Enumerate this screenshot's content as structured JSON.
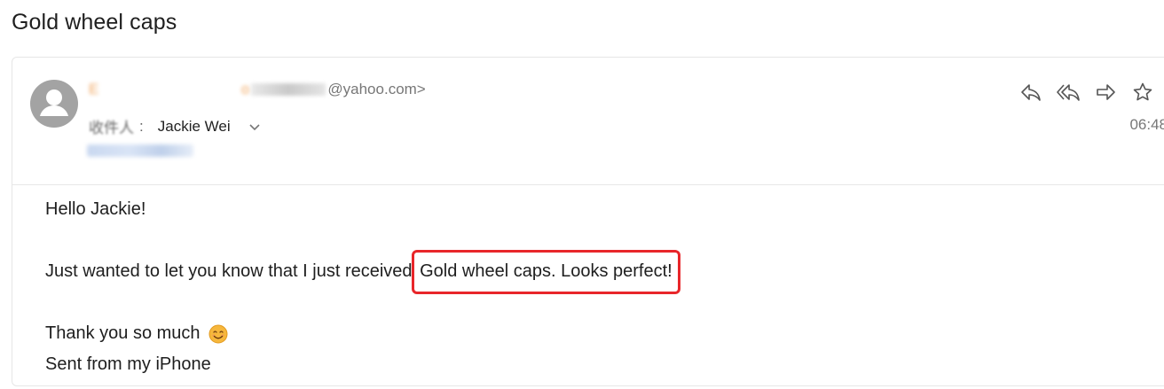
{
  "subject": "Gold wheel caps",
  "sender": {
    "address_suffix": "@yahoo.com>"
  },
  "recipients": {
    "to_label": "收件人",
    "to_name": "Jackie Wei"
  },
  "time": "06:48",
  "body": {
    "greeting": "Hello Jackie!",
    "line_prefix": "Just wanted to let you know that I just received ",
    "line_highlight": "Gold wheel caps. Looks perfect!",
    "thanks": "Thank you so much",
    "signature": "Sent from my iPhone"
  },
  "icons": [
    "avatar-icon",
    "reply-icon",
    "reply-all-icon",
    "forward-icon",
    "star-icon",
    "chevron-down-icon",
    "smile-emoji-icon"
  ],
  "colors": {
    "sender_name": "#f0a35a",
    "highlight_border": "#e8262a",
    "avatar_bg": "#a3a3a3"
  }
}
